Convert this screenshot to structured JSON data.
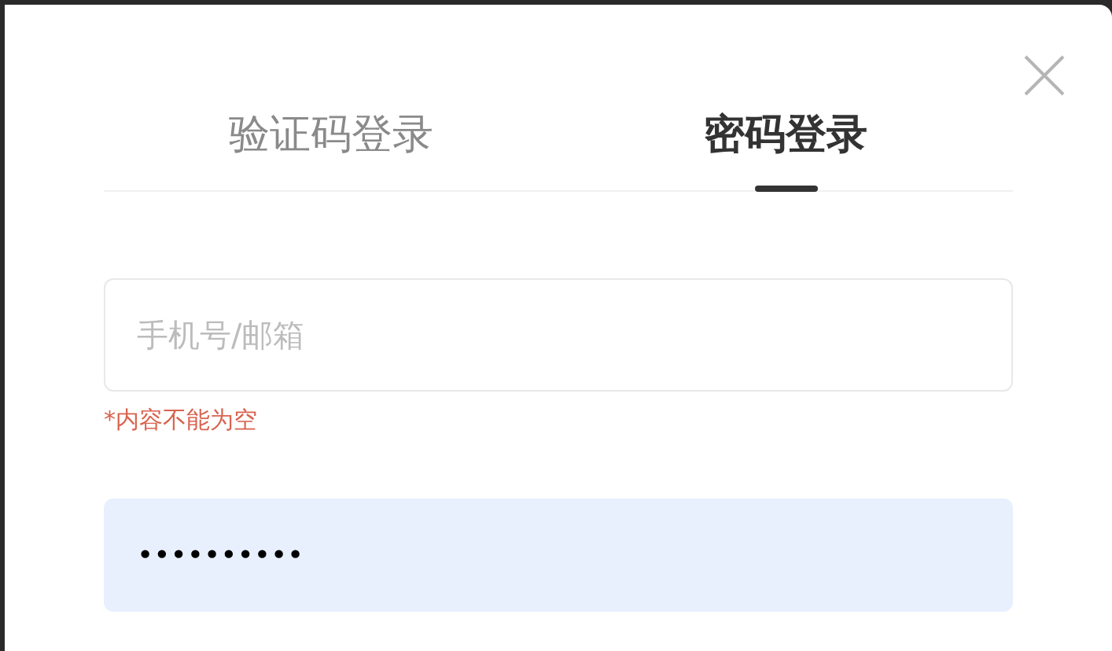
{
  "tabs": [
    {
      "label": "验证码登录",
      "selected": false
    },
    {
      "label": "密码登录",
      "selected": true
    }
  ],
  "account_field": {
    "placeholder": "手机号/邮箱"
  },
  "account_error": "*内容不能为空",
  "password_field": {
    "value": "••••••••••",
    "autofilled": true
  }
}
